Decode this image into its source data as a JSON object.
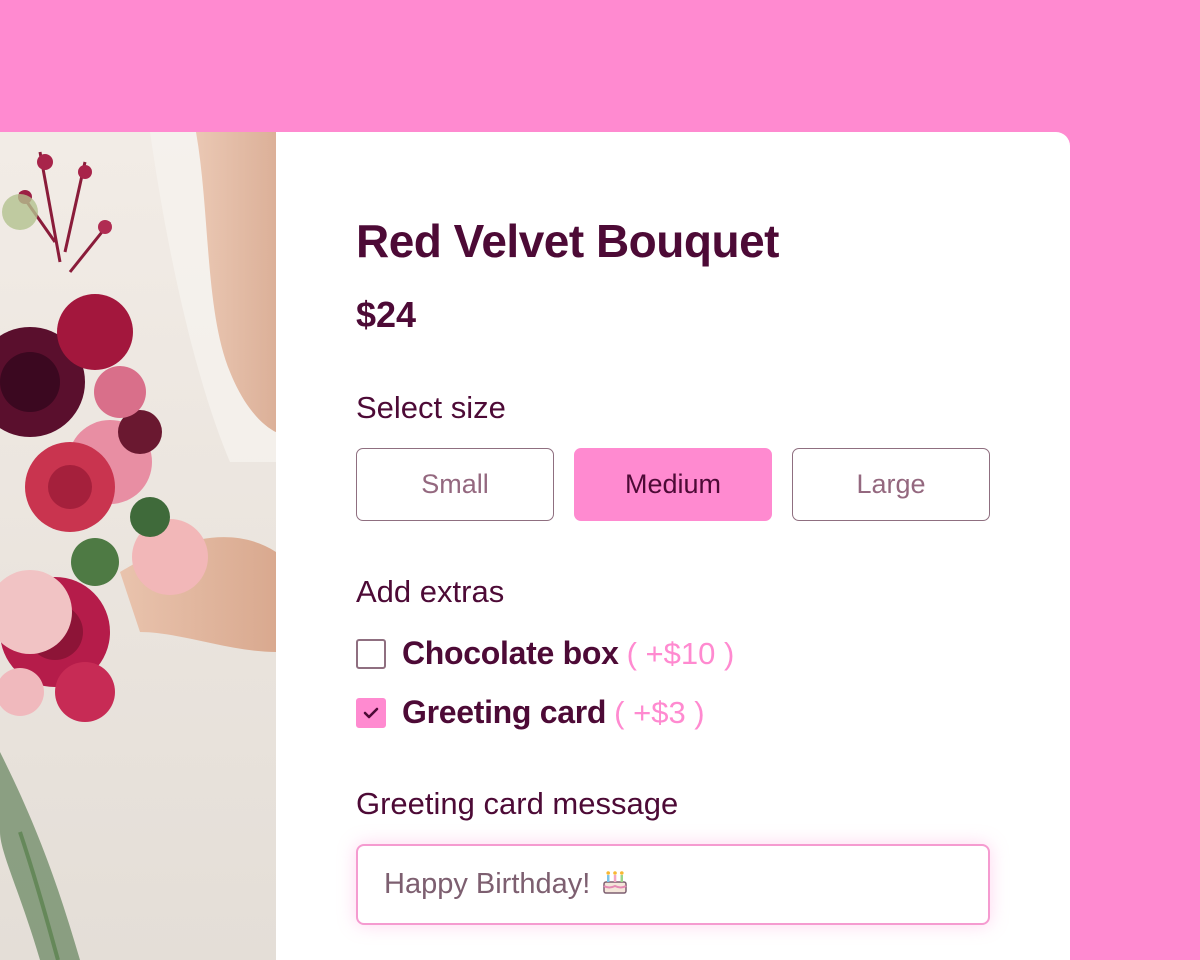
{
  "product": {
    "title": "Red Velvet Bouquet",
    "price": "$24",
    "image_alt": "bouquet-photo"
  },
  "size": {
    "label": "Select size",
    "options": [
      "Small",
      "Medium",
      "Large"
    ],
    "selected": "Medium"
  },
  "extras": {
    "label": "Add extras",
    "items": [
      {
        "label": "Chocolate box",
        "price": "( +$10 )",
        "checked": false
      },
      {
        "label": "Greeting card",
        "price": "( +$3 )",
        "checked": true
      }
    ]
  },
  "message": {
    "label": "Greeting card message",
    "value": "Happy Birthday!",
    "emoji_icon": "birthday-cake-icon"
  },
  "colors": {
    "background": "#ff8ad0",
    "accent": "#ff8ad0",
    "text_primary": "#4d0a36",
    "text_muted": "#94687f",
    "card": "#ffffff"
  }
}
